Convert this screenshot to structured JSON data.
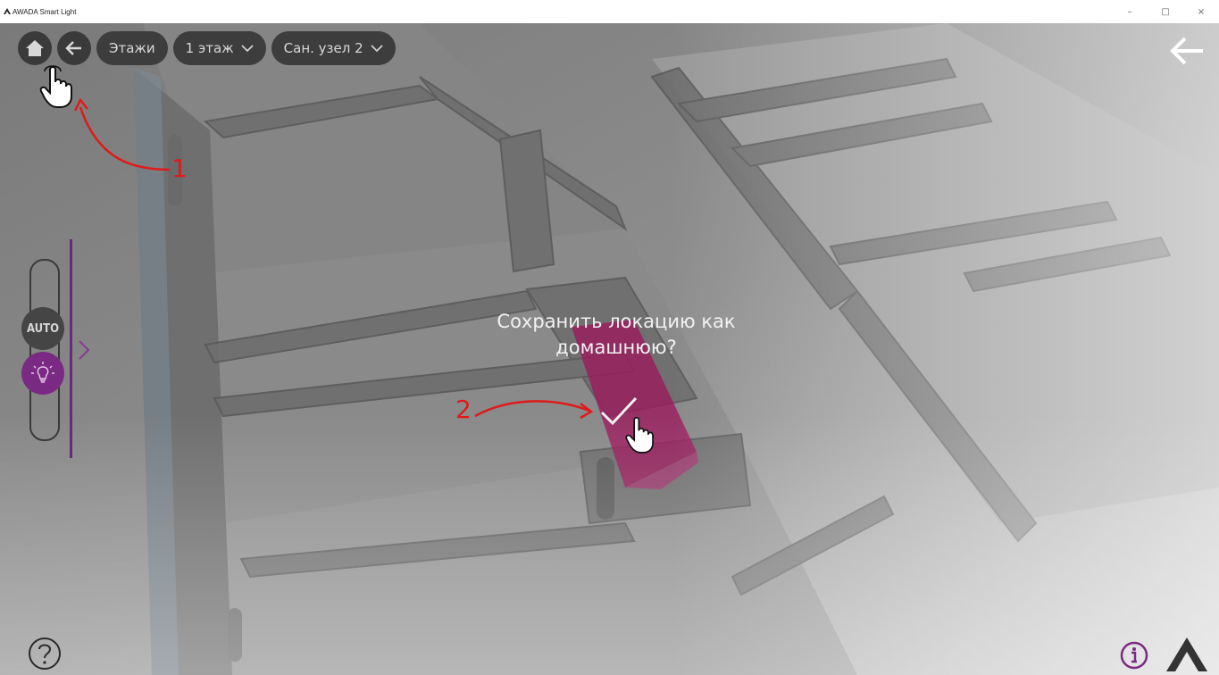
{
  "window": {
    "title": "AWADA Smart Light",
    "controls": {
      "minimize": "–",
      "maximize": "□",
      "close": "×"
    }
  },
  "toolbar": {
    "home_icon": "home-icon",
    "back_icon": "arrow-left-icon",
    "floors_label": "Этажи",
    "floor_label": "1 этаж",
    "room_label": "Сан. узел 2",
    "back_right_icon": "arrow-left-icon"
  },
  "light_control": {
    "auto_label": "AUTO",
    "bulb_icon": "lightbulb-icon",
    "expand_icon": "chevron-right-icon",
    "accent_color": "#7a2a82"
  },
  "dialog": {
    "line1": "Сохранить локацию как",
    "line2": "домашнюю?",
    "confirm_icon": "checkmark-icon",
    "highlight_color": "#9b1a5c"
  },
  "footer": {
    "help_icon": "question-circle-icon",
    "info_icon": "info-circle-icon",
    "brand_icon": "awada-logo-icon"
  },
  "annotations": {
    "step1": "1",
    "step2": "2",
    "color": "#e01a1a"
  }
}
